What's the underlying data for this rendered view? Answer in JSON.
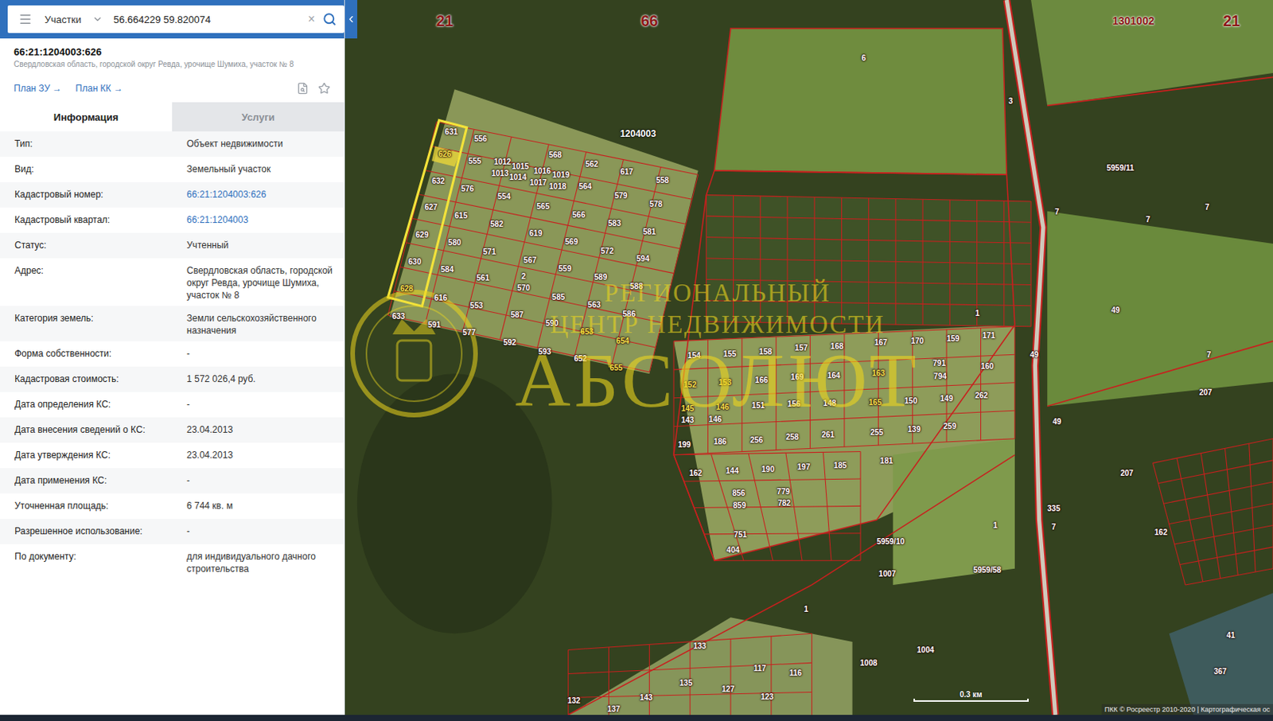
{
  "search": {
    "mode": "Участки",
    "query": "56.664229 59.820074",
    "clear": "×"
  },
  "object": {
    "title": "66:21:1204003:626",
    "address": "Свердловская область, городской округ Ревда, урочище Шумиха, участок № 8"
  },
  "links": [
    "План ЗУ →",
    "План КК →"
  ],
  "tabs": [
    {
      "label": "Информация",
      "selected": true
    },
    {
      "label": "Услуги",
      "selected": false
    }
  ],
  "fields": [
    {
      "label": "Тип:",
      "value": "Объект недвижимости",
      "kind": "text"
    },
    {
      "label": "Вид:",
      "value": "Земельный участок",
      "kind": "text"
    },
    {
      "label": "Кадастровый номер:",
      "value": "66:21:1204003:626",
      "kind": "link"
    },
    {
      "label": "Кадастровый квартал:",
      "value": "66:21:1204003",
      "kind": "link"
    },
    {
      "label": "Статус:",
      "value": "Учтенный",
      "kind": "text"
    },
    {
      "label": "Адрес:",
      "value": "Свердловская область, городской округ Ревда, урочище Шумиха, участок № 8",
      "kind": "text"
    },
    {
      "label": "Категория земель:",
      "value": "Земли сельскохозяйственного назначения",
      "kind": "text"
    },
    {
      "label": "Форма собственности:",
      "value": "-",
      "kind": "text"
    },
    {
      "label": "Кадастровая стоимость:",
      "value": "1 572 026,4 руб.",
      "kind": "text"
    },
    {
      "label": "Дата определения КС:",
      "value": "-",
      "kind": "text"
    },
    {
      "label": "Дата внесения сведений о КС:",
      "value": "23.04.2013",
      "kind": "text"
    },
    {
      "label": "Дата утверждения КС:",
      "value": "23.04.2013",
      "kind": "text"
    },
    {
      "label": "Дата применения КС:",
      "value": "-",
      "kind": "text"
    },
    {
      "label": "Уточненная площадь:",
      "value": "6 744 кв. м",
      "kind": "text"
    },
    {
      "label": "Разрешенное использование:",
      "value": "-",
      "kind": "text"
    },
    {
      "label": "По документу:",
      "value": "для индивидуального дачного строительства",
      "kind": "text"
    }
  ],
  "map": {
    "quarters": [
      {
        "label": "21",
        "kind": "region"
      },
      {
        "label": "66",
        "kind": "region"
      },
      {
        "label": "1301002",
        "kind": "code"
      },
      {
        "label": "21",
        "kind": "region"
      },
      {
        "label": "1204003",
        "kind": "block"
      }
    ],
    "parcels": [
      {
        "label": "631",
        "highlight": false
      },
      {
        "label": "626",
        "highlight": true
      },
      {
        "label": "556",
        "highlight": false
      },
      {
        "label": "555",
        "highlight": false
      },
      {
        "label": "1012",
        "highlight": false
      },
      {
        "label": "1015",
        "highlight": false
      },
      {
        "label": "568",
        "highlight": false
      },
      {
        "label": "562",
        "highlight": false
      },
      {
        "label": "617",
        "highlight": false
      },
      {
        "label": "558",
        "highlight": false
      },
      {
        "label": "1013",
        "highlight": false
      },
      {
        "label": "1014",
        "highlight": false
      },
      {
        "label": "1016",
        "highlight": false
      },
      {
        "label": "1019",
        "highlight": false
      },
      {
        "label": "1017",
        "highlight": false
      },
      {
        "label": "1018",
        "highlight": false
      },
      {
        "label": "632",
        "highlight": false
      },
      {
        "label": "576",
        "highlight": false
      },
      {
        "label": "554",
        "highlight": false
      },
      {
        "label": "564",
        "highlight": false
      },
      {
        "label": "579",
        "highlight": false
      },
      {
        "label": "578",
        "highlight": false
      },
      {
        "label": "627",
        "highlight": false
      },
      {
        "label": "565",
        "highlight": false
      },
      {
        "label": "566",
        "highlight": false
      },
      {
        "label": "583",
        "highlight": false
      },
      {
        "label": "581",
        "highlight": false
      },
      {
        "label": "615",
        "highlight": false
      },
      {
        "label": "582",
        "highlight": false
      },
      {
        "label": "619",
        "highlight": false
      },
      {
        "label": "569",
        "highlight": false
      },
      {
        "label": "572",
        "highlight": false
      },
      {
        "label": "594",
        "highlight": false
      },
      {
        "label": "629",
        "highlight": false
      },
      {
        "label": "580",
        "highlight": false
      },
      {
        "label": "571",
        "highlight": false
      },
      {
        "label": "567",
        "highlight": false
      },
      {
        "label": "559",
        "highlight": false
      },
      {
        "label": "589",
        "highlight": false
      },
      {
        "label": "588",
        "highlight": false
      },
      {
        "label": "630",
        "highlight": false
      },
      {
        "label": "584",
        "highlight": false
      },
      {
        "label": "561",
        "highlight": false
      },
      {
        "label": "2",
        "highlight": false
      },
      {
        "label": "570",
        "highlight": false
      },
      {
        "label": "585",
        "highlight": false
      },
      {
        "label": "563",
        "highlight": false
      },
      {
        "label": "586",
        "highlight": false
      },
      {
        "label": "628",
        "highlight": true
      },
      {
        "label": "616",
        "highlight": false
      },
      {
        "label": "553",
        "highlight": false
      },
      {
        "label": "587",
        "highlight": false
      },
      {
        "label": "590",
        "highlight": false
      },
      {
        "label": "653",
        "highlight": true
      },
      {
        "label": "654",
        "highlight": true
      },
      {
        "label": "633",
        "highlight": false
      },
      {
        "label": "591",
        "highlight": false
      },
      {
        "label": "577",
        "highlight": false
      },
      {
        "label": "592",
        "highlight": false
      },
      {
        "label": "593",
        "highlight": false
      },
      {
        "label": "652",
        "highlight": false
      },
      {
        "label": "655",
        "highlight": true
      },
      {
        "label": "154",
        "highlight": false
      },
      {
        "label": "155",
        "highlight": false
      },
      {
        "label": "158",
        "highlight": false
      },
      {
        "label": "157",
        "highlight": false
      },
      {
        "label": "168",
        "highlight": false
      },
      {
        "label": "167",
        "highlight": false
      },
      {
        "label": "170",
        "highlight": false
      },
      {
        "label": "159",
        "highlight": false
      },
      {
        "label": "171",
        "highlight": false
      },
      {
        "label": "1",
        "highlight": false
      },
      {
        "label": "152",
        "highlight": true
      },
      {
        "label": "153",
        "highlight": true
      },
      {
        "label": "166",
        "highlight": false
      },
      {
        "label": "169",
        "highlight": false
      },
      {
        "label": "164",
        "highlight": false
      },
      {
        "label": "163",
        "highlight": true
      },
      {
        "label": "791",
        "highlight": false
      },
      {
        "label": "794",
        "highlight": false
      },
      {
        "label": "160",
        "highlight": false
      },
      {
        "label": "145",
        "highlight": true
      },
      {
        "label": "146",
        "highlight": true
      },
      {
        "label": "151",
        "highlight": false
      },
      {
        "label": "156",
        "highlight": false
      },
      {
        "label": "148",
        "highlight": false
      },
      {
        "label": "165",
        "highlight": true
      },
      {
        "label": "150",
        "highlight": false
      },
      {
        "label": "149",
        "highlight": false
      },
      {
        "label": "262",
        "highlight": false
      },
      {
        "label": "143",
        "highlight": false
      },
      {
        "label": "146",
        "highlight": false
      },
      {
        "label": "199",
        "highlight": false
      },
      {
        "label": "186",
        "highlight": false
      },
      {
        "label": "256",
        "highlight": false
      },
      {
        "label": "258",
        "highlight": false
      },
      {
        "label": "261",
        "highlight": false
      },
      {
        "label": "255",
        "highlight": false
      },
      {
        "label": "139",
        "highlight": false
      },
      {
        "label": "259",
        "highlight": false
      },
      {
        "label": "162",
        "highlight": false
      },
      {
        "label": "144",
        "highlight": false
      },
      {
        "label": "190",
        "highlight": false
      },
      {
        "label": "197",
        "highlight": false
      },
      {
        "label": "185",
        "highlight": false
      },
      {
        "label": "181",
        "highlight": false
      },
      {
        "label": "856",
        "highlight": false
      },
      {
        "label": "859",
        "highlight": false
      },
      {
        "label": "779",
        "highlight": false
      },
      {
        "label": "782",
        "highlight": false
      },
      {
        "label": "751",
        "highlight": false
      },
      {
        "label": "404",
        "highlight": false
      },
      {
        "label": "5959/10",
        "highlight": false
      },
      {
        "label": "1007",
        "highlight": false
      },
      {
        "label": "5959/58",
        "highlight": false
      },
      {
        "label": "1",
        "highlight": false
      },
      {
        "label": "1008",
        "highlight": false
      },
      {
        "label": "1004",
        "highlight": false
      },
      {
        "label": "133",
        "highlight": false
      },
      {
        "label": "135",
        "highlight": false
      },
      {
        "label": "117",
        "highlight": false
      },
      {
        "label": "116",
        "highlight": false
      },
      {
        "label": "127",
        "highlight": false
      },
      {
        "label": "123",
        "highlight": false
      },
      {
        "label": "143",
        "highlight": false
      },
      {
        "label": "137",
        "highlight": false
      },
      {
        "label": "132",
        "highlight": false
      },
      {
        "label": "6",
        "highlight": false
      },
      {
        "label": "3",
        "highlight": false
      },
      {
        "label": "7",
        "highlight": false
      },
      {
        "label": "5959/11",
        "highlight": false
      },
      {
        "label": "7",
        "highlight": false
      },
      {
        "label": "7",
        "highlight": false
      },
      {
        "label": "49",
        "highlight": false
      },
      {
        "label": "7",
        "highlight": false
      },
      {
        "label": "49",
        "highlight": false
      },
      {
        "label": "207",
        "highlight": false
      },
      {
        "label": "49",
        "highlight": false
      },
      {
        "label": "207",
        "highlight": false
      },
      {
        "label": "1",
        "highlight": false
      },
      {
        "label": "335",
        "highlight": false
      },
      {
        "label": "7",
        "highlight": false
      },
      {
        "label": "162",
        "highlight": false
      },
      {
        "label": "41",
        "highlight": false
      },
      {
        "label": "367",
        "highlight": false
      }
    ],
    "watermark": [
      "РЕГИОНАЛЬНЫЙ",
      "ЦЕНТР НЕДВИЖИМОСТИ",
      "АБСОЛЮТ"
    ],
    "scale": "0.3 км",
    "copyright": "ПКК © Росреестр 2010-2020 | Картографическая ос"
  }
}
